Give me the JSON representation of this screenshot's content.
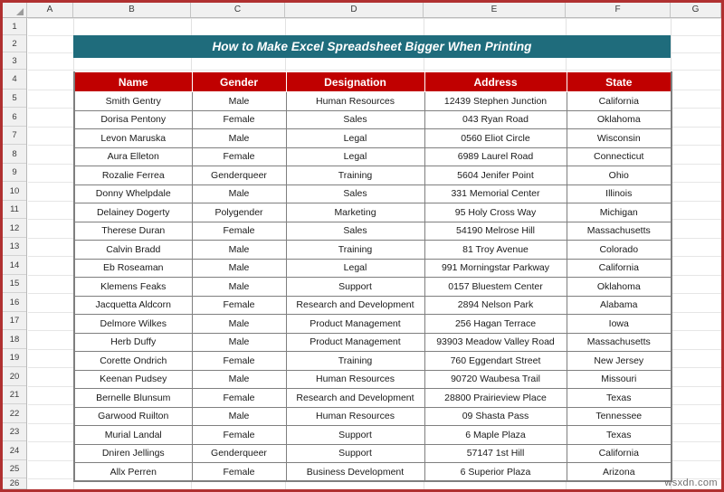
{
  "spreadsheet": {
    "column_headers": [
      "A",
      "B",
      "C",
      "D",
      "E",
      "F",
      "G"
    ],
    "row_headers": [
      "1",
      "2",
      "3",
      "4",
      "5",
      "6",
      "7",
      "8",
      "9",
      "10",
      "11",
      "12",
      "13",
      "14",
      "15",
      "16",
      "17",
      "18",
      "19",
      "20",
      "21",
      "22",
      "23",
      "24",
      "25",
      "26"
    ],
    "corner_icon": "select-all-triangle-icon"
  },
  "title": {
    "text": "How to Make Excel Spreadsheet Bigger When Printing",
    "background_color": "#1F6C7C",
    "text_color": "#FFFFFF"
  },
  "table": {
    "header_background": "#C00000",
    "header_text_color": "#FFFFFF",
    "columns": [
      "Name",
      "Gender",
      "Designation",
      "Address",
      "State"
    ],
    "rows": [
      [
        "Smith Gentry",
        "Male",
        "Human Resources",
        "12439 Stephen Junction",
        "California"
      ],
      [
        "Dorisa Pentony",
        "Female",
        "Sales",
        "043 Ryan Road",
        "Oklahoma"
      ],
      [
        "Levon Maruska",
        "Male",
        "Legal",
        "0560 Eliot Circle",
        "Wisconsin"
      ],
      [
        "Aura Elleton",
        "Female",
        "Legal",
        "6989 Laurel Road",
        "Connecticut"
      ],
      [
        "Rozalie Ferrea",
        "Genderqueer",
        "Training",
        "5604 Jenifer Point",
        "Ohio"
      ],
      [
        "Donny Whelpdale",
        "Male",
        "Sales",
        "331 Memorial Center",
        "Illinois"
      ],
      [
        "Delainey Dogerty",
        "Polygender",
        "Marketing",
        "95 Holy Cross Way",
        "Michigan"
      ],
      [
        "Therese Duran",
        "Female",
        "Sales",
        "54190 Melrose Hill",
        "Massachusetts"
      ],
      [
        "Calvin Bradd",
        "Male",
        "Training",
        "81 Troy Avenue",
        "Colorado"
      ],
      [
        "Eb Roseaman",
        "Male",
        "Legal",
        "991 Morningstar Parkway",
        "California"
      ],
      [
        "Klemens Feaks",
        "Male",
        "Support",
        "0157 Bluestem Center",
        "Oklahoma"
      ],
      [
        "Jacquetta Aldcorn",
        "Female",
        "Research and Development",
        "2894 Nelson Park",
        "Alabama"
      ],
      [
        "Delmore Wilkes",
        "Male",
        "Product Management",
        "256 Hagan Terrace",
        "Iowa"
      ],
      [
        "Herb Duffy",
        "Male",
        "Product Management",
        "93903 Meadow Valley Road",
        "Massachusetts"
      ],
      [
        "Corette Ondrich",
        "Female",
        "Training",
        "760 Eggendart Street",
        "New Jersey"
      ],
      [
        "Keenan Pudsey",
        "Male",
        "Human Resources",
        "90720 Waubesa Trail",
        "Missouri"
      ],
      [
        "Bernelle Blunsum",
        "Female",
        "Research and Development",
        "28800 Prairieview Place",
        "Texas"
      ],
      [
        "Garwood Ruilton",
        "Male",
        "Human Resources",
        "09 Shasta Pass",
        "Tennessee"
      ],
      [
        "Murial Landal",
        "Female",
        "Support",
        "6 Maple Plaza",
        "Texas"
      ],
      [
        "Dniren Jellings",
        "Genderqueer",
        "Support",
        "57147 1st Hill",
        "California"
      ],
      [
        "Allx Perren",
        "Female",
        "Business Development",
        "6 Superior Plaza",
        "Arizona"
      ]
    ]
  },
  "watermark": {
    "text": "wsxdn.com"
  }
}
